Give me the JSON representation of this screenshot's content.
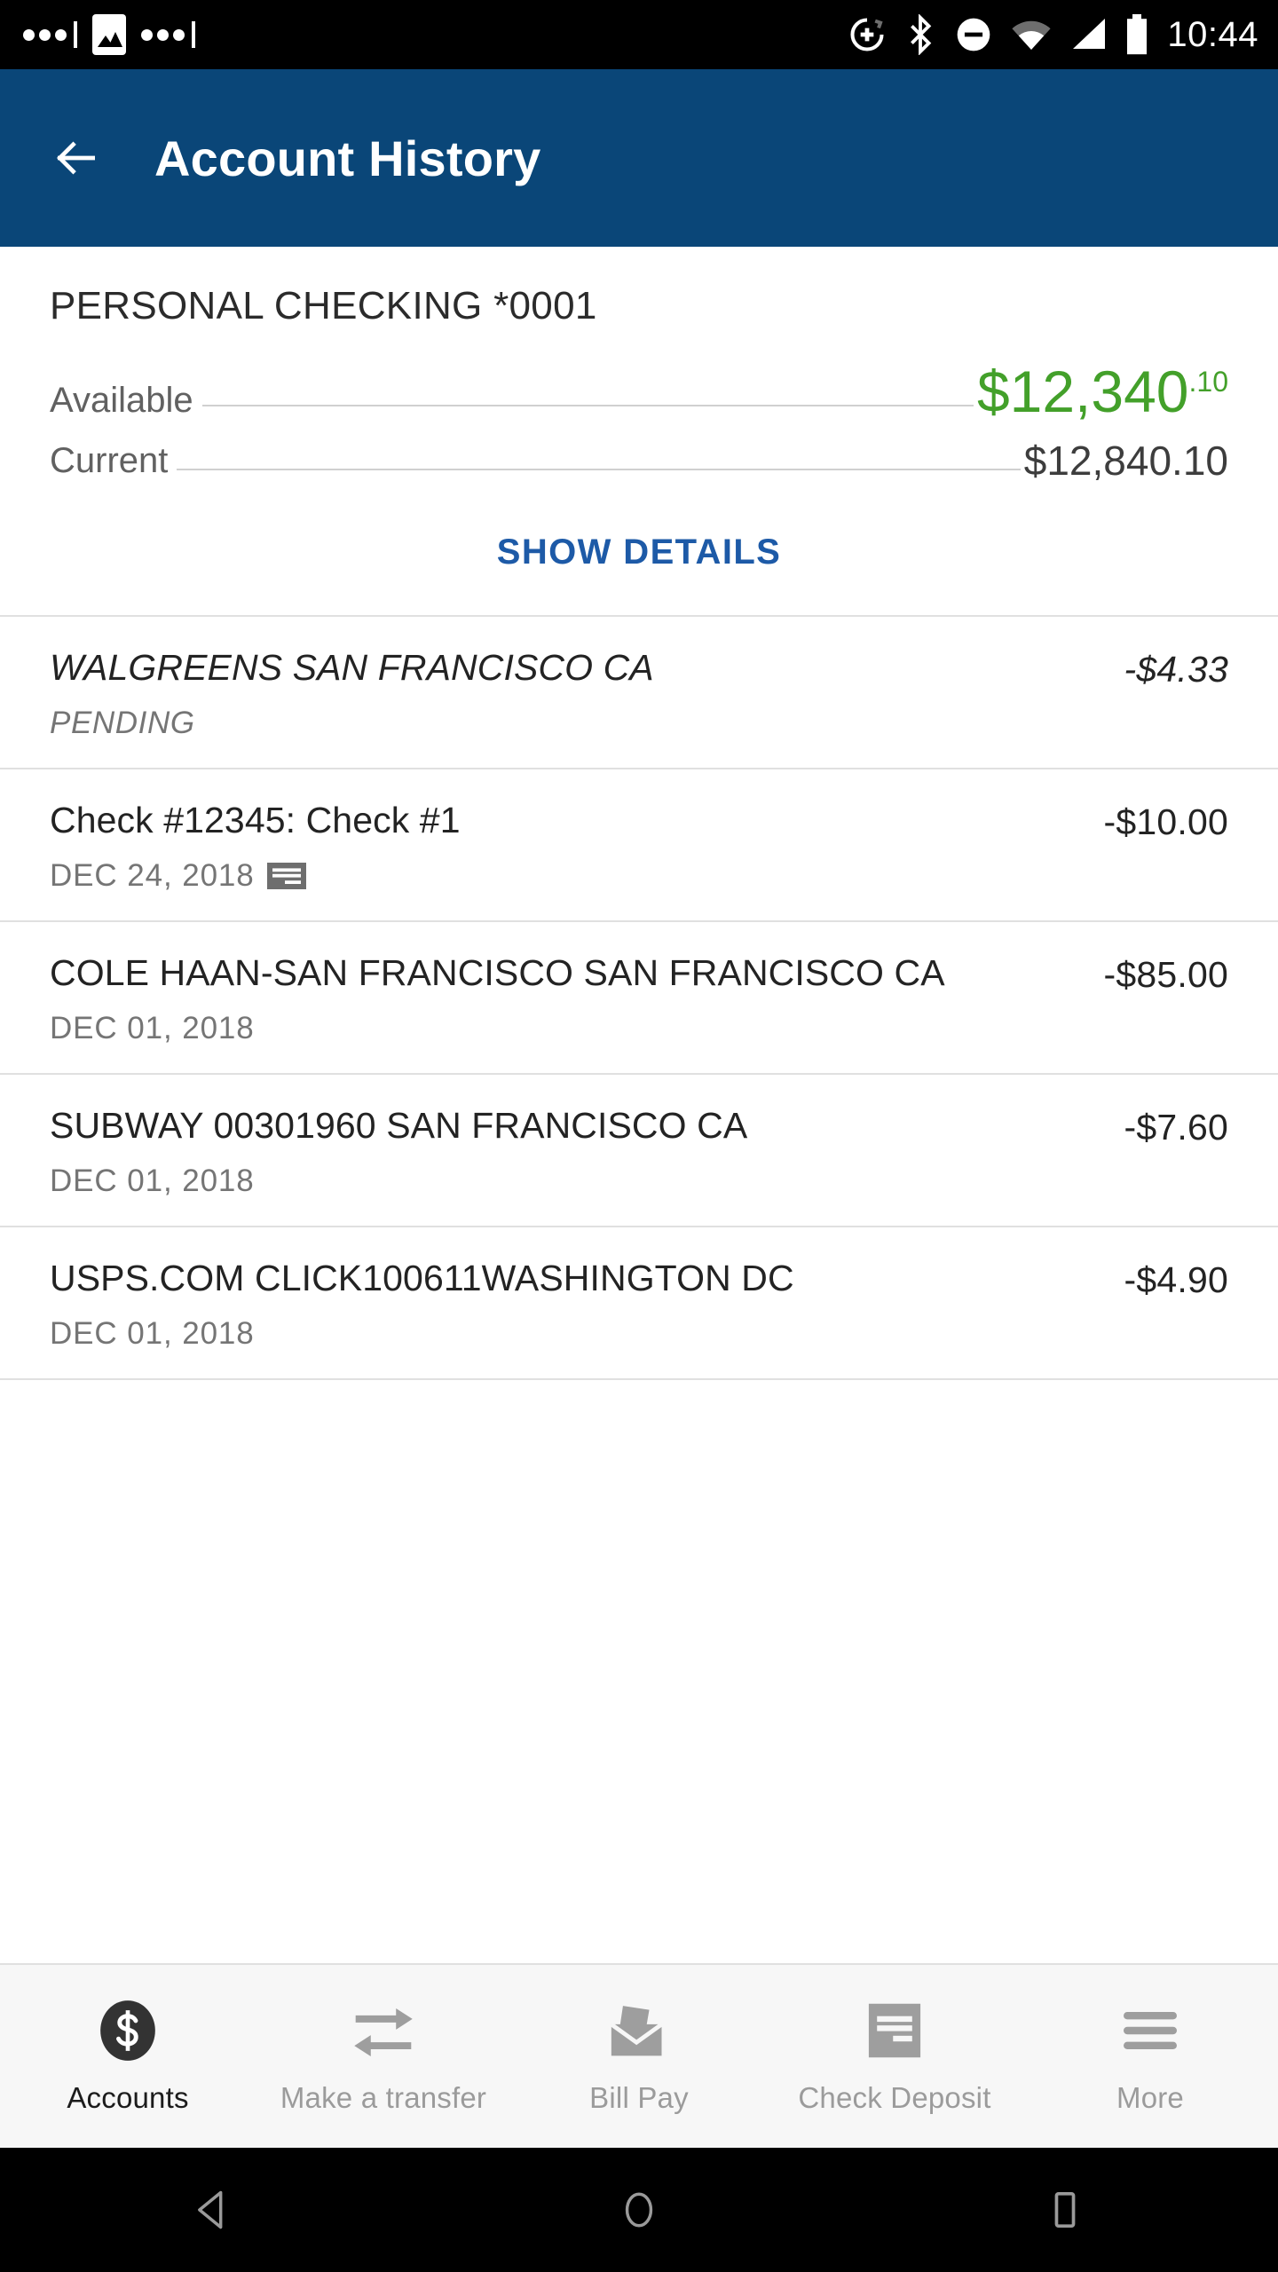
{
  "status_bar": {
    "time": "10:44",
    "left_icons": [
      "dots-indicator-icon",
      "photo-icon",
      "dots-indicator-icon"
    ],
    "right_icons": [
      "alarm-add-icon",
      "bluetooth-icon",
      "do-not-disturb-icon",
      "wifi-icon",
      "cellular-signal-icon",
      "battery-icon"
    ]
  },
  "app_bar": {
    "title": "Account History",
    "back_icon": "back-arrow-icon",
    "background_color": "#0a4678"
  },
  "summary": {
    "account_name": "PERSONAL CHECKING *0001",
    "available_label": "Available",
    "available_amount": "$12,340",
    "available_cents": ".10",
    "available_color": "#43a02a",
    "current_label": "Current",
    "current_amount": "$12,840.10",
    "show_details_label": "SHOW DETAILS",
    "show_details_color": "#1d5aa7"
  },
  "transactions": [
    {
      "description": "WALGREENS SAN FRANCISCO CA",
      "sub": "PENDING",
      "amount": "-$4.33",
      "pending": true,
      "icon": null
    },
    {
      "description": "Check #12345: Check #1",
      "sub": "DEC 24, 2018",
      "amount": "-$10.00",
      "pending": false,
      "icon": "check-image-icon"
    },
    {
      "description": "COLE HAAN-SAN FRANCISCO SAN FRANCISCO CA",
      "sub": "DEC 01, 2018",
      "amount": "-$85.00",
      "pending": false,
      "icon": null
    },
    {
      "description": "SUBWAY 00301960 SAN FRANCISCO CA",
      "sub": "DEC 01, 2018",
      "amount": "-$7.60",
      "pending": false,
      "icon": null
    },
    {
      "description": "USPS.COM CLICK100611WASHINGTON DC",
      "sub": "DEC 01, 2018",
      "amount": "-$4.90",
      "pending": false,
      "icon": null
    }
  ],
  "bottom_nav": [
    {
      "label": "Accounts",
      "icon": "dollar-circle-icon",
      "active": true
    },
    {
      "label": "Make a transfer",
      "icon": "transfer-arrows-icon",
      "active": false
    },
    {
      "label": "Bill Pay",
      "icon": "envelope-bill-icon",
      "active": false
    },
    {
      "label": "Check Deposit",
      "icon": "check-deposit-icon",
      "active": false
    },
    {
      "label": "More",
      "icon": "hamburger-menu-icon",
      "active": false
    }
  ],
  "system_nav": {
    "back_icon": "android-back-icon",
    "home_icon": "android-home-icon",
    "recents_icon": "android-recents-icon"
  }
}
